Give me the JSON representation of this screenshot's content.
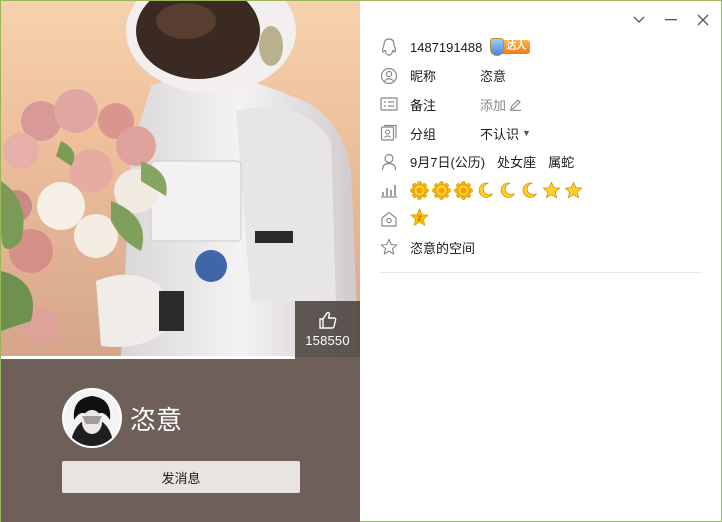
{
  "window": {
    "controls": {
      "dropdown": "chevron-down-icon",
      "minimize": "minimize-icon",
      "close": "close-icon"
    }
  },
  "cover": {
    "likes": "158550"
  },
  "profile": {
    "nickname": "恣意",
    "send_message_label": "发消息"
  },
  "info": {
    "qq_number": "1487191488",
    "vip_badge_label": "达人",
    "nickname_label": "昵称",
    "nickname_value": "恣意",
    "remark_label": "备注",
    "remark_action": "添加",
    "group_label": "分组",
    "group_value": "不认识",
    "birthday": "9月7日(公历)",
    "zodiac": "处女座",
    "chinese_zodiac": "属蛇",
    "levels": [
      "sun",
      "sun",
      "sun",
      "moon",
      "moon",
      "moon",
      "star",
      "star"
    ],
    "space_link": "恣意的空间"
  },
  "colors": {
    "left_panel_bg": "#6e6058",
    "button_bg": "#e8e4e1",
    "window_border": "#9cb55a",
    "level_gold": "#f5b400"
  }
}
